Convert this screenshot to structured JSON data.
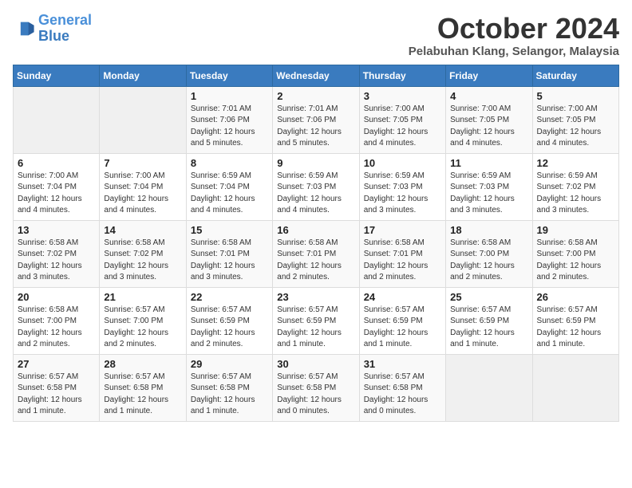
{
  "header": {
    "logo_line1": "General",
    "logo_line2": "Blue",
    "month": "October 2024",
    "location": "Pelabuhan Klang, Selangor, Malaysia"
  },
  "days_of_week": [
    "Sunday",
    "Monday",
    "Tuesday",
    "Wednesday",
    "Thursday",
    "Friday",
    "Saturday"
  ],
  "weeks": [
    [
      {
        "day": "",
        "info": ""
      },
      {
        "day": "",
        "info": ""
      },
      {
        "day": "1",
        "info": "Sunrise: 7:01 AM\nSunset: 7:06 PM\nDaylight: 12 hours\nand 5 minutes."
      },
      {
        "day": "2",
        "info": "Sunrise: 7:01 AM\nSunset: 7:06 PM\nDaylight: 12 hours\nand 5 minutes."
      },
      {
        "day": "3",
        "info": "Sunrise: 7:00 AM\nSunset: 7:05 PM\nDaylight: 12 hours\nand 4 minutes."
      },
      {
        "day": "4",
        "info": "Sunrise: 7:00 AM\nSunset: 7:05 PM\nDaylight: 12 hours\nand 4 minutes."
      },
      {
        "day": "5",
        "info": "Sunrise: 7:00 AM\nSunset: 7:05 PM\nDaylight: 12 hours\nand 4 minutes."
      }
    ],
    [
      {
        "day": "6",
        "info": "Sunrise: 7:00 AM\nSunset: 7:04 PM\nDaylight: 12 hours\nand 4 minutes."
      },
      {
        "day": "7",
        "info": "Sunrise: 7:00 AM\nSunset: 7:04 PM\nDaylight: 12 hours\nand 4 minutes."
      },
      {
        "day": "8",
        "info": "Sunrise: 6:59 AM\nSunset: 7:04 PM\nDaylight: 12 hours\nand 4 minutes."
      },
      {
        "day": "9",
        "info": "Sunrise: 6:59 AM\nSunset: 7:03 PM\nDaylight: 12 hours\nand 4 minutes."
      },
      {
        "day": "10",
        "info": "Sunrise: 6:59 AM\nSunset: 7:03 PM\nDaylight: 12 hours\nand 3 minutes."
      },
      {
        "day": "11",
        "info": "Sunrise: 6:59 AM\nSunset: 7:03 PM\nDaylight: 12 hours\nand 3 minutes."
      },
      {
        "day": "12",
        "info": "Sunrise: 6:59 AM\nSunset: 7:02 PM\nDaylight: 12 hours\nand 3 minutes."
      }
    ],
    [
      {
        "day": "13",
        "info": "Sunrise: 6:58 AM\nSunset: 7:02 PM\nDaylight: 12 hours\nand 3 minutes."
      },
      {
        "day": "14",
        "info": "Sunrise: 6:58 AM\nSunset: 7:02 PM\nDaylight: 12 hours\nand 3 minutes."
      },
      {
        "day": "15",
        "info": "Sunrise: 6:58 AM\nSunset: 7:01 PM\nDaylight: 12 hours\nand 3 minutes."
      },
      {
        "day": "16",
        "info": "Sunrise: 6:58 AM\nSunset: 7:01 PM\nDaylight: 12 hours\nand 2 minutes."
      },
      {
        "day": "17",
        "info": "Sunrise: 6:58 AM\nSunset: 7:01 PM\nDaylight: 12 hours\nand 2 minutes."
      },
      {
        "day": "18",
        "info": "Sunrise: 6:58 AM\nSunset: 7:00 PM\nDaylight: 12 hours\nand 2 minutes."
      },
      {
        "day": "19",
        "info": "Sunrise: 6:58 AM\nSunset: 7:00 PM\nDaylight: 12 hours\nand 2 minutes."
      }
    ],
    [
      {
        "day": "20",
        "info": "Sunrise: 6:58 AM\nSunset: 7:00 PM\nDaylight: 12 hours\nand 2 minutes."
      },
      {
        "day": "21",
        "info": "Sunrise: 6:57 AM\nSunset: 7:00 PM\nDaylight: 12 hours\nand 2 minutes."
      },
      {
        "day": "22",
        "info": "Sunrise: 6:57 AM\nSunset: 6:59 PM\nDaylight: 12 hours\nand 2 minutes."
      },
      {
        "day": "23",
        "info": "Sunrise: 6:57 AM\nSunset: 6:59 PM\nDaylight: 12 hours\nand 1 minute."
      },
      {
        "day": "24",
        "info": "Sunrise: 6:57 AM\nSunset: 6:59 PM\nDaylight: 12 hours\nand 1 minute."
      },
      {
        "day": "25",
        "info": "Sunrise: 6:57 AM\nSunset: 6:59 PM\nDaylight: 12 hours\nand 1 minute."
      },
      {
        "day": "26",
        "info": "Sunrise: 6:57 AM\nSunset: 6:59 PM\nDaylight: 12 hours\nand 1 minute."
      }
    ],
    [
      {
        "day": "27",
        "info": "Sunrise: 6:57 AM\nSunset: 6:58 PM\nDaylight: 12 hours\nand 1 minute."
      },
      {
        "day": "28",
        "info": "Sunrise: 6:57 AM\nSunset: 6:58 PM\nDaylight: 12 hours\nand 1 minute."
      },
      {
        "day": "29",
        "info": "Sunrise: 6:57 AM\nSunset: 6:58 PM\nDaylight: 12 hours\nand 1 minute."
      },
      {
        "day": "30",
        "info": "Sunrise: 6:57 AM\nSunset: 6:58 PM\nDaylight: 12 hours\nand 0 minutes."
      },
      {
        "day": "31",
        "info": "Sunrise: 6:57 AM\nSunset: 6:58 PM\nDaylight: 12 hours\nand 0 minutes."
      },
      {
        "day": "",
        "info": ""
      },
      {
        "day": "",
        "info": ""
      }
    ]
  ]
}
